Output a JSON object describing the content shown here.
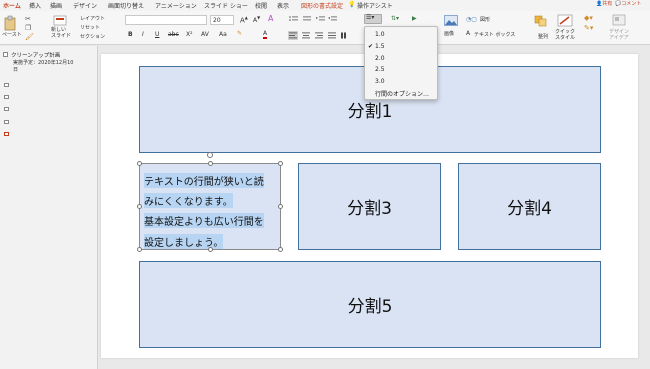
{
  "tabs": [
    {
      "label": "ホーム",
      "active": true
    },
    {
      "label": "挿入"
    },
    {
      "label": "描画"
    },
    {
      "label": "デザイン"
    },
    {
      "label": "画面切り替え"
    },
    {
      "label": "アニメーション"
    },
    {
      "label": "スライド ショー"
    },
    {
      "label": "校閲"
    },
    {
      "label": "表示"
    },
    {
      "label": "図形の書式設定"
    },
    {
      "label": "操作アシスト"
    }
  ],
  "header_actions": {
    "share": "共有",
    "comment": "コメント"
  },
  "ribbon": {
    "paste": "ペースト",
    "new_slide": "新しい\nスライド",
    "layout": "レイアウト",
    "reset": "リセット",
    "section": "セクション",
    "font_size": "20",
    "picture": "画像",
    "shapes": "図形",
    "text_box": "テキスト ボックス",
    "arrange": "整列",
    "quick_styles": "クイック\nスタイル",
    "design_ideas": "デザイン\nアイデア"
  },
  "outline": {
    "title": "クリーンアップ計画",
    "detail1": "実施予定：2020年12月10",
    "detail2": "日"
  },
  "line_spacing_menu": {
    "items": [
      "1.0",
      "1.5",
      "2.0",
      "2.5",
      "3.0",
      "行間のオプション…"
    ],
    "selected": "1.5"
  },
  "slide": {
    "boxes": {
      "b1": "分割1",
      "b3": "分割3",
      "b4": "分割4",
      "b5": "分割5"
    },
    "textbox_lines": [
      "テキストの行間が狭いと読",
      "みにくくなります。",
      "基本設定よりも広い行間を",
      "設定しましょう。"
    ]
  },
  "colors": {
    "accent": "#c43e1c",
    "shape_fill": "#dae3f3",
    "shape_border": "#41719c",
    "text_highlight": "#b7d4f3"
  }
}
